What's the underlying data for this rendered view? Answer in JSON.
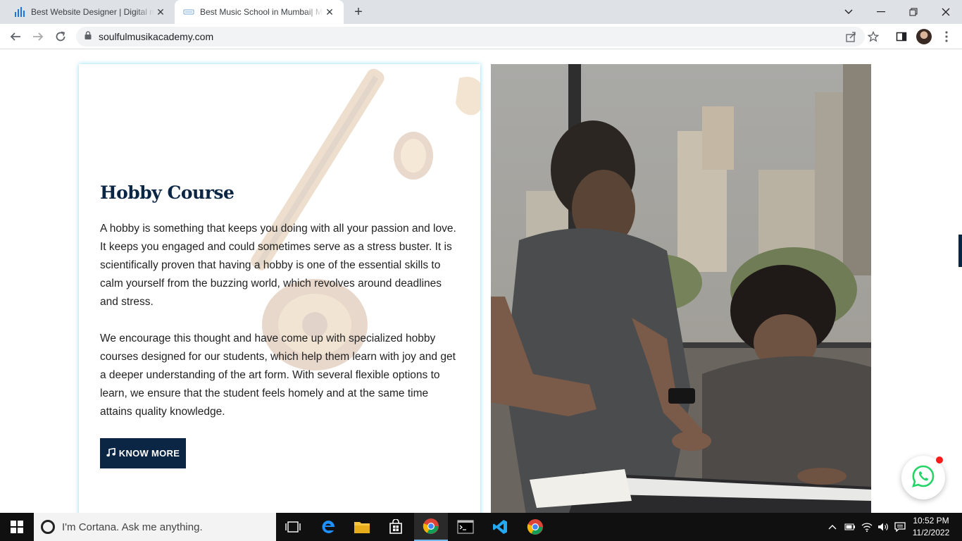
{
  "browser": {
    "tabs": [
      {
        "title": "Best Website Designer | Digital m",
        "icon": "bar-chart-favicon"
      },
      {
        "title": "Best Music School in Mumbai| M",
        "icon": "music-favicon"
      }
    ],
    "url": "soulfulmusikacademy.com"
  },
  "page": {
    "card": {
      "title": "Hobby Course",
      "paragraph1": "A hobby is something that keeps you doing with all your passion and love. It keeps you engaged and could sometimes serve as a stress buster. It is scientifically proven that having a hobby is one of the essential skills to calm yourself from the buzzing world, which revolves around deadlines and stress.",
      "paragraph2": "We encourage this thought and have come up with specialized hobby courses designed for our students, which help them learn with joy and get a deeper understanding of the art form. With several flexible options to learn, we ensure that the student feels homely and at the same time attains quality knowledge.",
      "button_label": "KNOW MORE",
      "button_icon": "music-note-icon"
    },
    "colors": {
      "navy": "#0b2545",
      "whatsapp_green": "#25d366",
      "notification_red": "#ff1a1a"
    }
  },
  "taskbar": {
    "search_placeholder": "I'm Cortana. Ask me anything.",
    "time": "10:52 PM",
    "date": "11/2/2022"
  }
}
